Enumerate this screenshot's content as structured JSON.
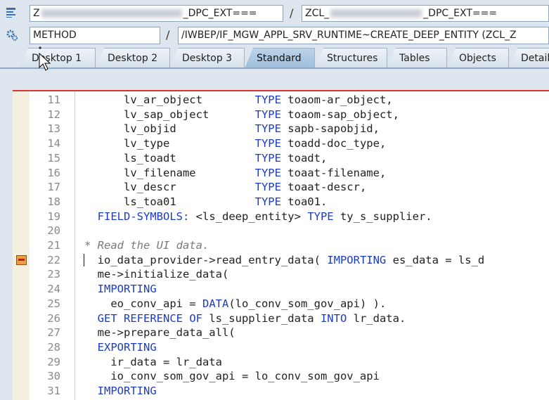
{
  "header": {
    "class_field": "Z                                  _DPC_EXT===",
    "class_prefix": "Z",
    "class_suffix": "_DPC_EXT===",
    "right_class_prefix": "ZCL_",
    "right_class_suffix": "_DPC_EXT===",
    "separator": "/",
    "type_field": "METHOD",
    "method_field": "/IWBEP/IF_MGW_APPL_SRV_RUNTIME~CREATE_DEEP_ENTITY (ZCL_Z"
  },
  "tabs": [
    {
      "label": "Desktop 1"
    },
    {
      "label": "Desktop 2"
    },
    {
      "label": "Desktop 3"
    },
    {
      "label": "Standard",
      "active": true
    },
    {
      "label": "Structures"
    },
    {
      "label": "Tables"
    },
    {
      "label": "Objects"
    },
    {
      "label": "Detail"
    }
  ],
  "code": [
    {
      "n": "11",
      "parts": [
        [
          "",
          "      lv_ar_object        "
        ],
        [
          "kw",
          "TYPE"
        ],
        [
          "",
          " toaom-ar_object,"
        ]
      ]
    },
    {
      "n": "12",
      "parts": [
        [
          "",
          "      lv_sap_object       "
        ],
        [
          "kw",
          "TYPE"
        ],
        [
          "",
          " toaom-sap_object,"
        ]
      ]
    },
    {
      "n": "13",
      "parts": [
        [
          "",
          "      lv_objid            "
        ],
        [
          "kw",
          "TYPE"
        ],
        [
          "",
          " sapb-sapobjid,"
        ]
      ]
    },
    {
      "n": "14",
      "parts": [
        [
          "",
          "      lv_type             "
        ],
        [
          "kw",
          "TYPE"
        ],
        [
          "",
          " toadd-doc_type,"
        ]
      ]
    },
    {
      "n": "15",
      "parts": [
        [
          "",
          "      ls_toadt            "
        ],
        [
          "kw",
          "TYPE"
        ],
        [
          "",
          " toadt,"
        ]
      ]
    },
    {
      "n": "16",
      "parts": [
        [
          "",
          "      lv_filename         "
        ],
        [
          "kw",
          "TYPE"
        ],
        [
          "",
          " toaat-filename,"
        ]
      ]
    },
    {
      "n": "17",
      "parts": [
        [
          "",
          "      lv_descr            "
        ],
        [
          "kw",
          "TYPE"
        ],
        [
          "",
          " toaat-descr,"
        ]
      ]
    },
    {
      "n": "18",
      "parts": [
        [
          "",
          "      ls_toa01            "
        ],
        [
          "kw",
          "TYPE"
        ],
        [
          "",
          " toa01."
        ]
      ]
    },
    {
      "n": "19",
      "parts": [
        [
          "",
          "  "
        ],
        [
          "kw",
          "FIELD-SYMBOLS:"
        ],
        [
          "",
          " <ls_deep_entity> "
        ],
        [
          "kw",
          "TYPE"
        ],
        [
          "",
          " ty_s_supplier."
        ]
      ]
    },
    {
      "n": "20",
      "parts": [
        [
          "",
          ""
        ]
      ]
    },
    {
      "n": "21",
      "parts": [
        [
          "cm",
          "* Read the UI data."
        ]
      ]
    },
    {
      "n": "22",
      "breakpoint": true,
      "parts": [
        [
          "",
          "  io_data_provider->read_entry_data( "
        ],
        [
          "kw",
          "IMPORTING"
        ],
        [
          "",
          " es_data = ls_d"
        ]
      ]
    },
    {
      "n": "23",
      "parts": [
        [
          "",
          "  me->initialize_data("
        ]
      ]
    },
    {
      "n": "24",
      "parts": [
        [
          "",
          "  "
        ],
        [
          "kw",
          "IMPORTING"
        ]
      ]
    },
    {
      "n": "25",
      "parts": [
        [
          "",
          "    eo_conv_api = "
        ],
        [
          "kw",
          "DATA"
        ],
        [
          "",
          "(lo_conv_som_gov_api) )."
        ]
      ]
    },
    {
      "n": "26",
      "parts": [
        [
          "",
          "  "
        ],
        [
          "kw",
          "GET REFERENCE OF"
        ],
        [
          "",
          " ls_supplier_data "
        ],
        [
          "kw",
          "INTO"
        ],
        [
          "",
          " lr_data."
        ]
      ]
    },
    {
      "n": "27",
      "parts": [
        [
          "",
          "  me->prepare_data_all("
        ]
      ]
    },
    {
      "n": "28",
      "parts": [
        [
          "",
          "  "
        ],
        [
          "kw",
          "EXPORTING"
        ]
      ]
    },
    {
      "n": "29",
      "parts": [
        [
          "",
          "    ir_data = lr_data"
        ]
      ]
    },
    {
      "n": "30",
      "parts": [
        [
          "",
          "    io_conv_som_gov_api = lo_conv_som_gov_api"
        ]
      ]
    },
    {
      "n": "31",
      "parts": [
        [
          "",
          "  "
        ],
        [
          "kw",
          "IMPORTING"
        ]
      ]
    }
  ],
  "colors": {
    "keyword": "#1a3bc9",
    "comment": "#7a7a7a",
    "active_tab": "#a9c5e1"
  }
}
